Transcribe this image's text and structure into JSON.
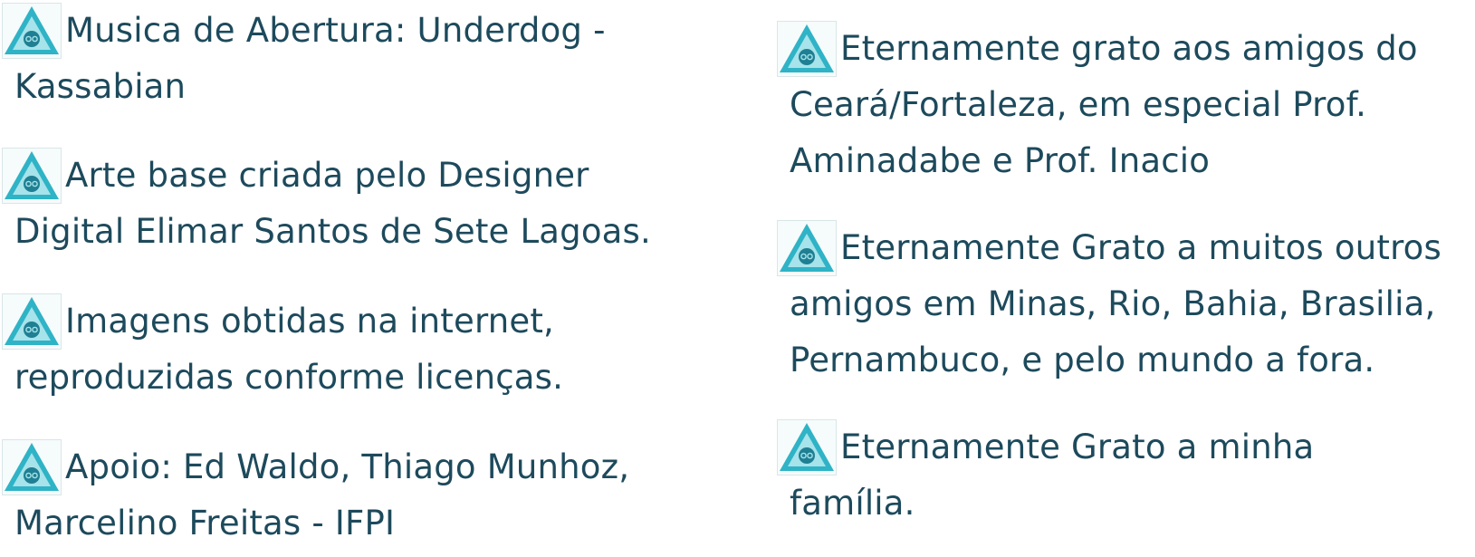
{
  "left": [
    {
      "lines": [
        "Musica de Abertura: Underdog -",
        "Kassabian"
      ]
    },
    {
      "lines": [
        "Arte base criada pelo Designer",
        "Digital Elimar Santos de Sete Lagoas."
      ]
    },
    {
      "lines": [
        "Imagens obtidas na internet,",
        "reproduzidas conforme licenças."
      ]
    },
    {
      "lines": [
        "Apoio: Ed Waldo, Thiago Munhoz,",
        "Marcelino Freitas - IFPI"
      ]
    }
  ],
  "right": [
    {
      "lines": [
        "Eternamente grato aos amigos do",
        "Ceará/Fortaleza, em especial Prof.",
        "Aminadabe e Prof. Inacio"
      ]
    },
    {
      "lines": [
        "Eternamente Grato a muitos outros",
        "amigos em Minas, Rio, Bahia, Brasilia,",
        "Pernambuco, e pelo mundo a fora."
      ]
    },
    {
      "lines": [
        "Eternamente Grato a minha",
        "família."
      ]
    }
  ],
  "icon": "triangle-eye-bullet-icon",
  "colors": {
    "text": "#1d4a5c",
    "icon_triangle": "#2fb3c6",
    "icon_triangle_light": "#a7e3ea",
    "icon_eye": "#1f7f93"
  }
}
